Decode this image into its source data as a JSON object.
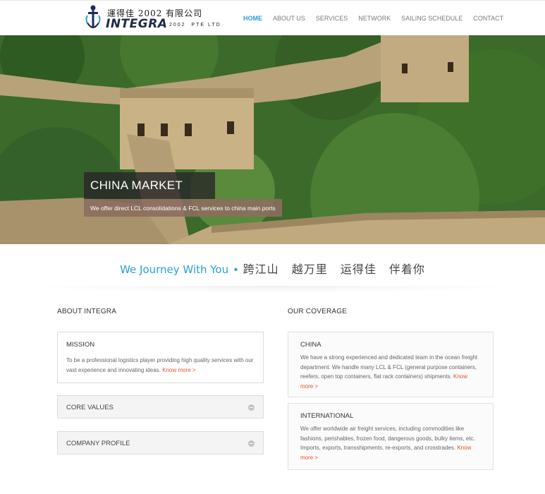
{
  "brand": {
    "cn": "運得佳 2002 有限公司",
    "name": "INTEGRA",
    "year": "2002",
    "suffix": "PTE  LTD"
  },
  "nav": [
    {
      "label": "HOME",
      "active": true
    },
    {
      "label": "ABOUT US",
      "active": false
    },
    {
      "label": "SERVICES",
      "active": false
    },
    {
      "label": "NETWORK",
      "active": false
    },
    {
      "label": "SAILING SCHEDULE",
      "active": false
    },
    {
      "label": "CONTACT",
      "active": false
    }
  ],
  "hero": {
    "title": "CHINA MARKET",
    "subtitle": "We offer direct LCL consolidations & FCL services to china main ports"
  },
  "tagline": {
    "en": "We Journey With You",
    "dot": "•",
    "cn": "跨江山 越万里 运得佳 伴着你"
  },
  "about": {
    "heading": "ABOUT INTEGRA",
    "mission": {
      "title": "MISSION",
      "body": "To be a professional logistics player providing high quality services with our vast experience and innovating ideas.",
      "link": "Know more >"
    },
    "accordion": [
      {
        "title": "CORE VALUES"
      },
      {
        "title": "COMPANY PROFILE"
      }
    ]
  },
  "coverage": {
    "heading": "OUR COVERAGE",
    "items": [
      {
        "title": "CHINA",
        "body": "We have a strong experienced and dedicated team in the ocean freight department. We handle many LCL & FCL (general purpose containers, reefers, open top containers, flat rack containers) shipments.",
        "link": "Know more >"
      },
      {
        "title": "INTERNATIONAL",
        "body": "We offer worldwide air freight services, including commodities like fashions, perishables, frozen food, dangerous goods, bulky items, etc. Imports, exports, transshipments, re-exports, and crosstrades.",
        "link": "Know more >"
      }
    ]
  },
  "colors": {
    "accent": "#2a9fd6",
    "link": "#e8502a"
  }
}
